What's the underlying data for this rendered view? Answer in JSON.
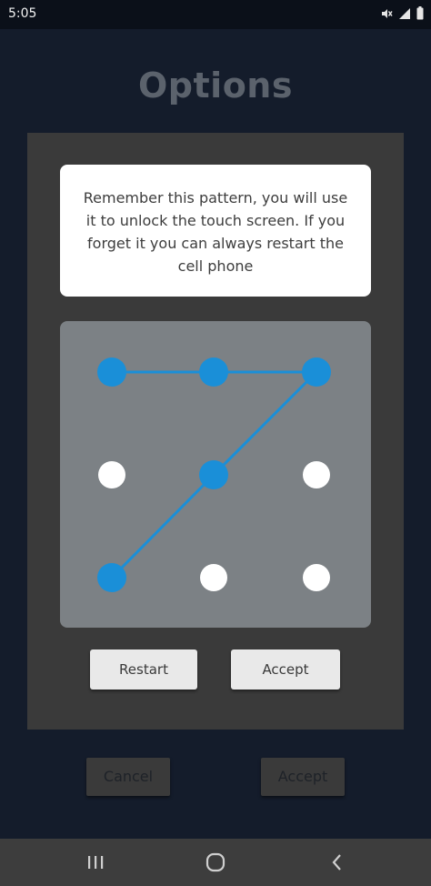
{
  "status_bar": {
    "time": "5:05",
    "icons": [
      "mute-icon",
      "signal-icon",
      "battery-icon"
    ]
  },
  "page": {
    "title": "Options"
  },
  "dialog": {
    "message": "Remember this pattern, you will use it to unlock the touch screen. If you forget it you can always restart the cell phone",
    "pattern": {
      "grid": [
        3,
        3
      ],
      "selected_sequence": [
        [
          0,
          0
        ],
        [
          1,
          0
        ],
        [
          2,
          0
        ],
        [
          1,
          1
        ],
        [
          0,
          2
        ]
      ],
      "colors": {
        "pad_background": "#7c8185",
        "selected_dot": "#1a8fd8",
        "unselected_dot": "#ffffff",
        "line": "#1a8fd8"
      }
    },
    "restart_label": "Restart",
    "accept_label": "Accept"
  },
  "footer": {
    "cancel_label": "Cancel",
    "accept_label": "Accept"
  },
  "nav_bar": {
    "icons": [
      "recents-icon",
      "home-icon",
      "back-icon"
    ]
  },
  "colors": {
    "background": "#141c2b",
    "title": "#5b626c",
    "dialog": "#3a3a3a",
    "nav_bar": "#3d3d3d"
  }
}
